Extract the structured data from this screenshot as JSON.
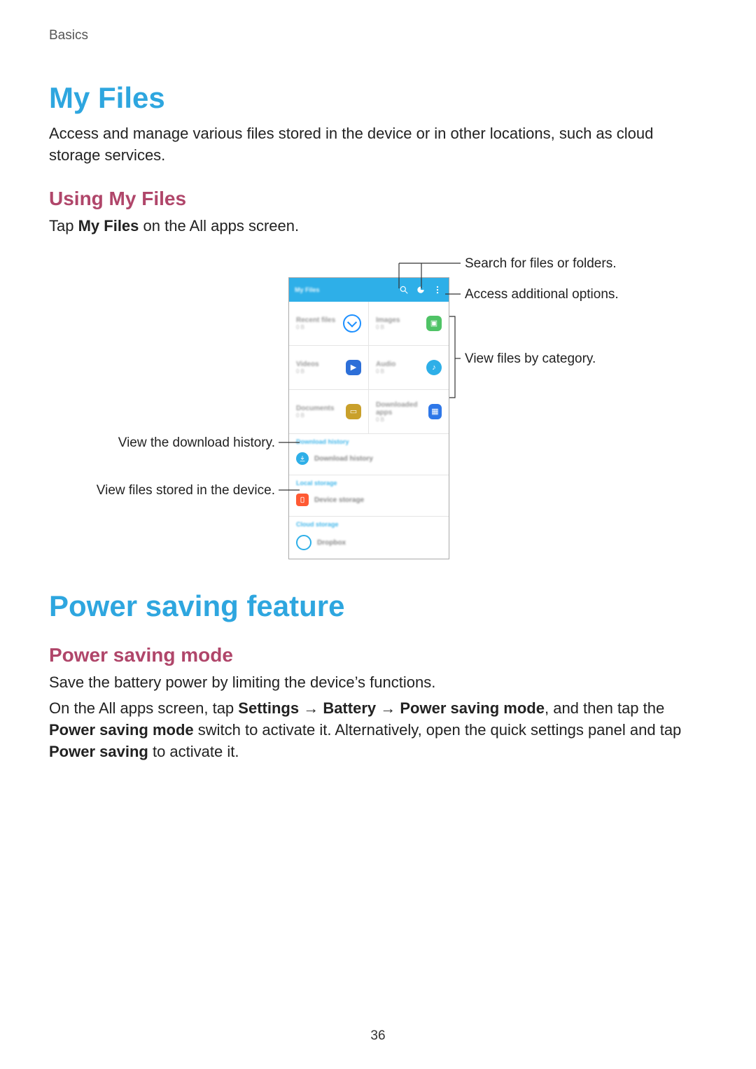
{
  "breadcrumb": "Basics",
  "page_number": "36",
  "s1": {
    "title": "My Files",
    "intro": "Access and manage various files stored in the device or in other locations, such as cloud storage services.",
    "sub_title": "Using My Files",
    "sub_text_pre": "Tap ",
    "sub_text_bold": "My Files",
    "sub_text_post": " on the All apps screen."
  },
  "diagram": {
    "title": "My Files",
    "callouts": {
      "search": "Search for files or folders.",
      "options": "Access additional options.",
      "categories": "View files by category.",
      "download_history": "View the download history.",
      "device_storage": "View files stored in the device."
    },
    "categories": [
      {
        "label": "Recent files",
        "sub": "0 B"
      },
      {
        "label": "Images",
        "sub": "0 B"
      },
      {
        "label": "Videos",
        "sub": "0 B"
      },
      {
        "label": "Audio",
        "sub": "0 B"
      },
      {
        "label": "Documents",
        "sub": "0 B"
      },
      {
        "label": "Downloaded apps",
        "sub": "0 B"
      }
    ],
    "sections": {
      "download": {
        "head": "Download history",
        "row": "Download history"
      },
      "local": {
        "head": "Local storage",
        "row": "Device storage"
      },
      "cloud": {
        "head": "Cloud storage",
        "row": "Dropbox"
      }
    }
  },
  "s2": {
    "title": "Power saving feature",
    "sub_title": "Power saving mode",
    "p1": "Save the battery power by limiting the device’s functions.",
    "p2a": "On the All apps screen, tap ",
    "p2b1": "Settings",
    "p2arrow": " → ",
    "p2b2": "Battery",
    "p2b3": "Power saving mode",
    "p2c": ", and then tap the ",
    "p2d": "Power saving mode",
    "p2e": " switch to activate it. Alternatively, open the quick settings panel and tap ",
    "p2f": "Power saving",
    "p2g": " to activate it."
  }
}
